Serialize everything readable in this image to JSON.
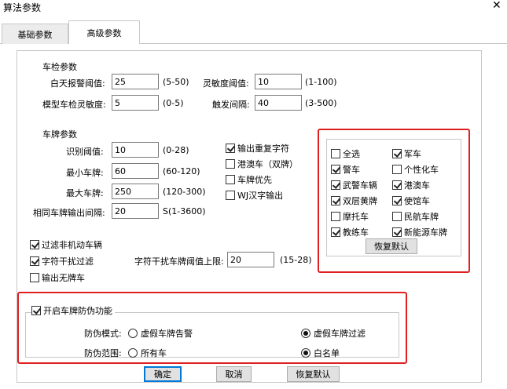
{
  "window": {
    "title": "算法参数",
    "close": "✕"
  },
  "tabs": [
    {
      "label": "基础参数"
    },
    {
      "label": "高级参数"
    }
  ],
  "vehicle": {
    "heading": "车检参数",
    "daytime_alarm_label": "白天报警阈值:",
    "daytime_alarm_value": "25",
    "daytime_alarm_range": "(5-50)",
    "sensitivity_label": "灵敏度阈值:",
    "sensitivity_value": "10",
    "sensitivity_range": "(1-100)",
    "model_sensitivity_label": "模型车检灵敏度:",
    "model_sensitivity_value": "5",
    "model_sensitivity_range": "(0-5)",
    "trigger_interval_label": "触发间隔:",
    "trigger_interval_value": "40",
    "trigger_interval_range": "(3-500)"
  },
  "plate": {
    "heading": "车牌参数",
    "recog_label": "识别阈值:",
    "recog_value": "10",
    "recog_range": "(0-28)",
    "min_label": "最小车牌:",
    "min_value": "60",
    "min_range": "(60-120)",
    "max_label": "最大车牌:",
    "max_value": "250",
    "max_range": "(120-300)",
    "same_interval_label": "相同车牌输出间隔:",
    "same_interval_value": "20",
    "same_interval_range": "S(1-3600)"
  },
  "plate_options": [
    {
      "label": "输出重复字符",
      "checked": true
    },
    {
      "label": "港澳车（双牌）",
      "checked": false
    },
    {
      "label": "车牌优先",
      "checked": false
    },
    {
      "label": "WJ汉字输出",
      "checked": false
    }
  ],
  "filters": {
    "non_motor": {
      "label": "过滤非机动车辆",
      "checked": true
    },
    "char_interfere": {
      "label": "字符干扰过滤",
      "checked": true
    },
    "no_plate": {
      "label": "输出无牌车",
      "checked": false
    },
    "interfere_limit_label": "字符干扰车牌阈值上限:",
    "interfere_limit_value": "20",
    "interfere_limit_range": "(15-28)"
  },
  "types": {
    "left": [
      {
        "label": "全选",
        "checked": false
      },
      {
        "label": "警车",
        "checked": true
      },
      {
        "label": "武警车辆",
        "checked": true
      },
      {
        "label": "双层黄牌",
        "checked": true
      },
      {
        "label": "摩托车",
        "checked": false
      },
      {
        "label": "教练车",
        "checked": true
      }
    ],
    "right": [
      {
        "label": "军车",
        "checked": true
      },
      {
        "label": "个性化车",
        "checked": false
      },
      {
        "label": "港澳车",
        "checked": true
      },
      {
        "label": "使馆车",
        "checked": true
      },
      {
        "label": "民航车牌",
        "checked": false
      },
      {
        "label": "新能源车牌",
        "checked": true
      }
    ],
    "restore_label": "恢复默认"
  },
  "anti_fake": {
    "enable_label": "开启车牌防伪功能",
    "enable_checked": true,
    "mode_label": "防伪模式:",
    "mode_options": [
      {
        "label": "虚假车牌告警",
        "selected": false
      },
      {
        "label": "虚假车牌过滤",
        "selected": true
      }
    ],
    "range_label": "防伪范围:",
    "range_options": [
      {
        "label": "所有车",
        "selected": false
      },
      {
        "label": "白名单",
        "selected": true
      }
    ]
  },
  "footer": {
    "ok": "确定",
    "cancel": "取消",
    "restore": "恢复默认"
  },
  "colors": {
    "highlight_red": "#e02020",
    "accent_blue": "#0078d7"
  }
}
